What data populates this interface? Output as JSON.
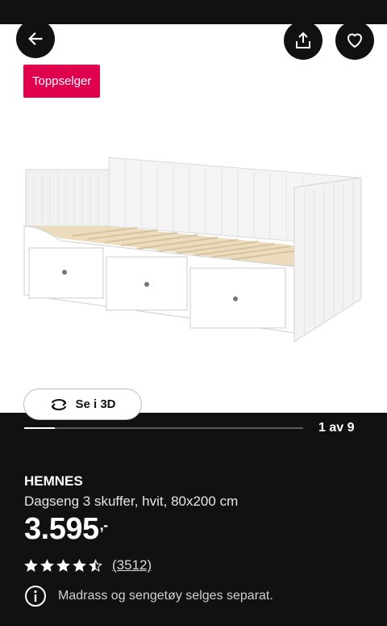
{
  "header": {
    "back_icon": "arrow-left-icon",
    "share_icon": "share-icon",
    "favorite_icon": "heart-icon"
  },
  "badge": {
    "label": "Toppselger",
    "color": "#e0004d"
  },
  "gallery": {
    "view_3d_label": "Se i 3D",
    "view_3d_icon": "rotate-3d-icon",
    "current": 1,
    "total": 9,
    "counter_text": "1 av 9"
  },
  "product": {
    "name": "HEMNES",
    "description": "Dagseng 3 skuffer, hvit, 80x200 cm",
    "price": "3.595",
    "price_suffix": ",-",
    "rating": 4.5,
    "rating_max": 5,
    "review_count": "(3512)",
    "info_icon": "info-icon",
    "info_text": "Madrass og sengetøy selges separat."
  }
}
